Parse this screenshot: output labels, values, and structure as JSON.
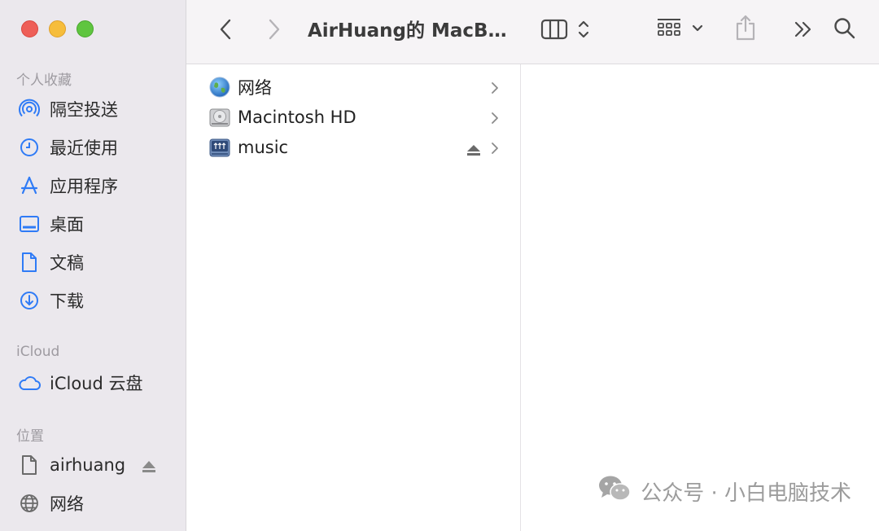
{
  "window": {
    "title": "AirHuang的 MacBook Pro"
  },
  "sidebar": {
    "favorites_title": "个人收藏",
    "favorites": [
      {
        "label": "隔空投送",
        "icon": "airdrop-icon"
      },
      {
        "label": "最近使用",
        "icon": "clock-icon"
      },
      {
        "label": "应用程序",
        "icon": "applications-icon"
      },
      {
        "label": "桌面",
        "icon": "desktop-icon"
      },
      {
        "label": "文稿",
        "icon": "document-icon"
      },
      {
        "label": "下载",
        "icon": "download-icon"
      }
    ],
    "icloud_title": "iCloud",
    "icloud": [
      {
        "label": "iCloud 云盘",
        "icon": "cloud-icon"
      }
    ],
    "locations_title": "位置",
    "locations": [
      {
        "label": "airhuang",
        "icon": "file-icon"
      },
      {
        "label": "网络",
        "icon": "globe-icon"
      }
    ]
  },
  "columns": {
    "first": [
      {
        "label": "网络",
        "icon": "network-globe-icon"
      },
      {
        "label": "Macintosh HD",
        "icon": "hard-drive-icon"
      },
      {
        "label": "music",
        "icon": "network-drive-icon"
      }
    ]
  },
  "watermark": {
    "text": "公众号 · 小白电脑技术"
  },
  "colors": {
    "accent": "#2f7bf6",
    "sidebar_bg": "#ebe8ed",
    "toolbar_bg": "#f6f4f6"
  }
}
